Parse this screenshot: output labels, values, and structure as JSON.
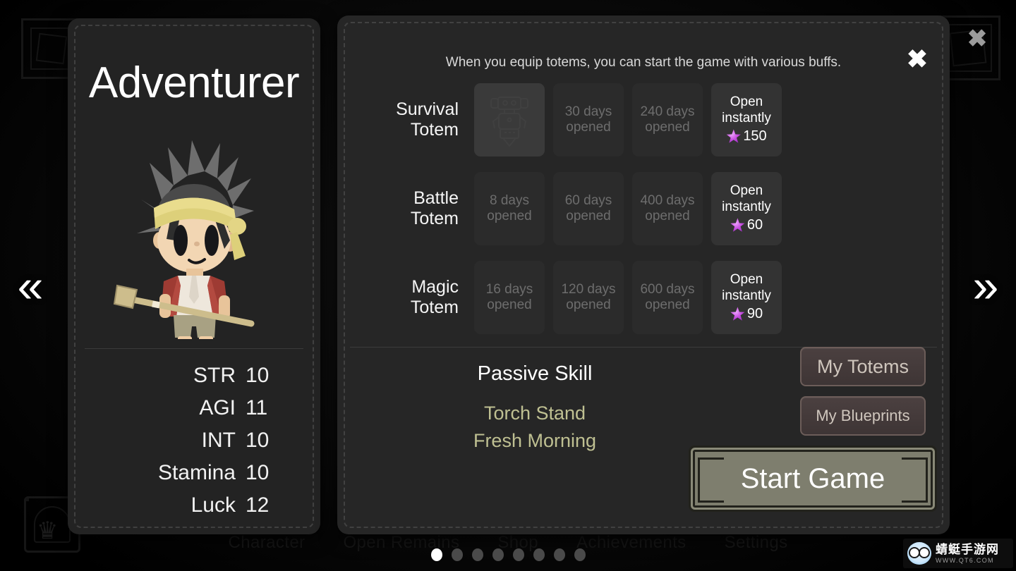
{
  "background": {
    "nav_items": [
      "Character",
      "Open Remains",
      "Shop",
      "Achievements",
      "Settings"
    ],
    "crown_icon": "crown-icon",
    "outer_close_label": "✖"
  },
  "nav_arrows": {
    "prev_label": "«",
    "next_label": "»"
  },
  "character_panel": {
    "name": "Adventurer",
    "sprite_name": "adventurer-sprite",
    "stats": [
      {
        "label": "STR",
        "value": "10"
      },
      {
        "label": "AGI",
        "value": "11"
      },
      {
        "label": "INT",
        "value": "10"
      },
      {
        "label": "Stamina",
        "value": "10"
      },
      {
        "label": "Luck",
        "value": "12"
      }
    ]
  },
  "totem_panel": {
    "close_label": "✖",
    "hint": "When you equip totems, you can start the game with various buffs.",
    "rows": [
      {
        "title": "Survival\nTotem",
        "title_line1": "Survival",
        "title_line2": "Totem",
        "slots": [
          {
            "state": "owned",
            "icon": "totem-idol-icon",
            "label": ""
          },
          {
            "state": "locked",
            "line1": "30 days",
            "line2": "opened"
          },
          {
            "state": "locked",
            "line1": "240 days",
            "line2": "opened"
          },
          {
            "state": "buy",
            "line1": "Open",
            "line2": "instantly",
            "price": "150",
            "currency_icon": "gem-icon"
          }
        ]
      },
      {
        "title": "Battle\nTotem",
        "title_line1": "Battle",
        "title_line2": "Totem",
        "slots": [
          {
            "state": "locked",
            "line1": "8 days",
            "line2": "opened"
          },
          {
            "state": "locked",
            "line1": "60 days",
            "line2": "opened"
          },
          {
            "state": "locked",
            "line1": "400 days",
            "line2": "opened"
          },
          {
            "state": "buy",
            "line1": "Open",
            "line2": "instantly",
            "price": "60",
            "currency_icon": "gem-icon"
          }
        ]
      },
      {
        "title": "Magic\nTotem",
        "title_line1": "Magic",
        "title_line2": "Totem",
        "slots": [
          {
            "state": "locked",
            "line1": "16 days",
            "line2": "opened"
          },
          {
            "state": "locked",
            "line1": "120 days",
            "line2": "opened"
          },
          {
            "state": "locked",
            "line1": "600 days",
            "line2": "opened"
          },
          {
            "state": "buy",
            "line1": "Open",
            "line2": "instantly",
            "price": "90",
            "currency_icon": "gem-icon"
          }
        ]
      }
    ],
    "passive": {
      "heading": "Passive Skill",
      "items": [
        "Torch Stand",
        "Fresh Morning"
      ]
    },
    "buttons": {
      "my_totems": "My Totems",
      "my_blueprints": "My Blueprints",
      "start_game": "Start Game"
    }
  },
  "pager": {
    "total": 8,
    "active_index": 0
  },
  "watermark": {
    "name_cn": "蜻蜓手游网",
    "url": "WWW.QT6.COM"
  },
  "colors": {
    "panel_bg": "#242424",
    "accent_gem": "#c64fe0",
    "passive_text": "#bfc092",
    "start_button": "#7e7e6e"
  }
}
